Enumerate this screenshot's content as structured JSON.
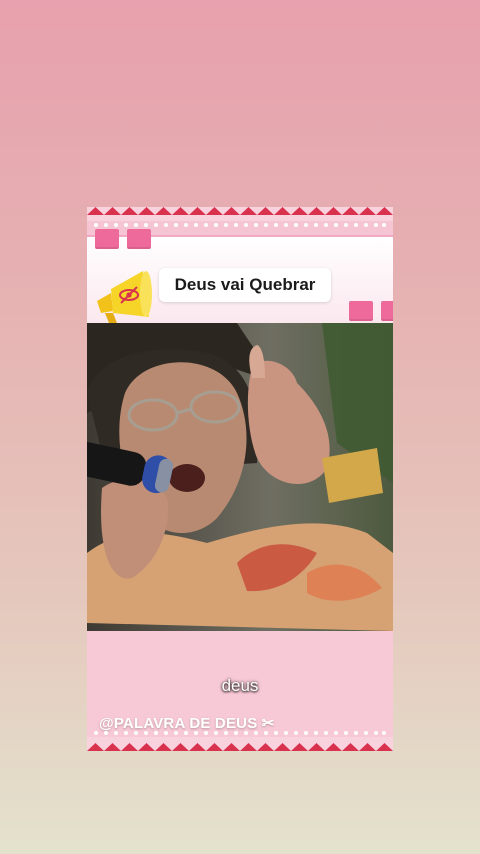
{
  "header": {
    "title": "Deus vai Quebrar",
    "megaphone_icon": "megaphone-icon"
  },
  "video": {
    "subtitle": "deus"
  },
  "watermark": {
    "text": "@PALAVRA DE DEUS ✂"
  },
  "colors": {
    "accent_pink": "#ee6a9a",
    "zigzag_red": "#d8324f",
    "card_bg": "#f5c5d3",
    "megaphone_yellow": "#f6d428"
  }
}
